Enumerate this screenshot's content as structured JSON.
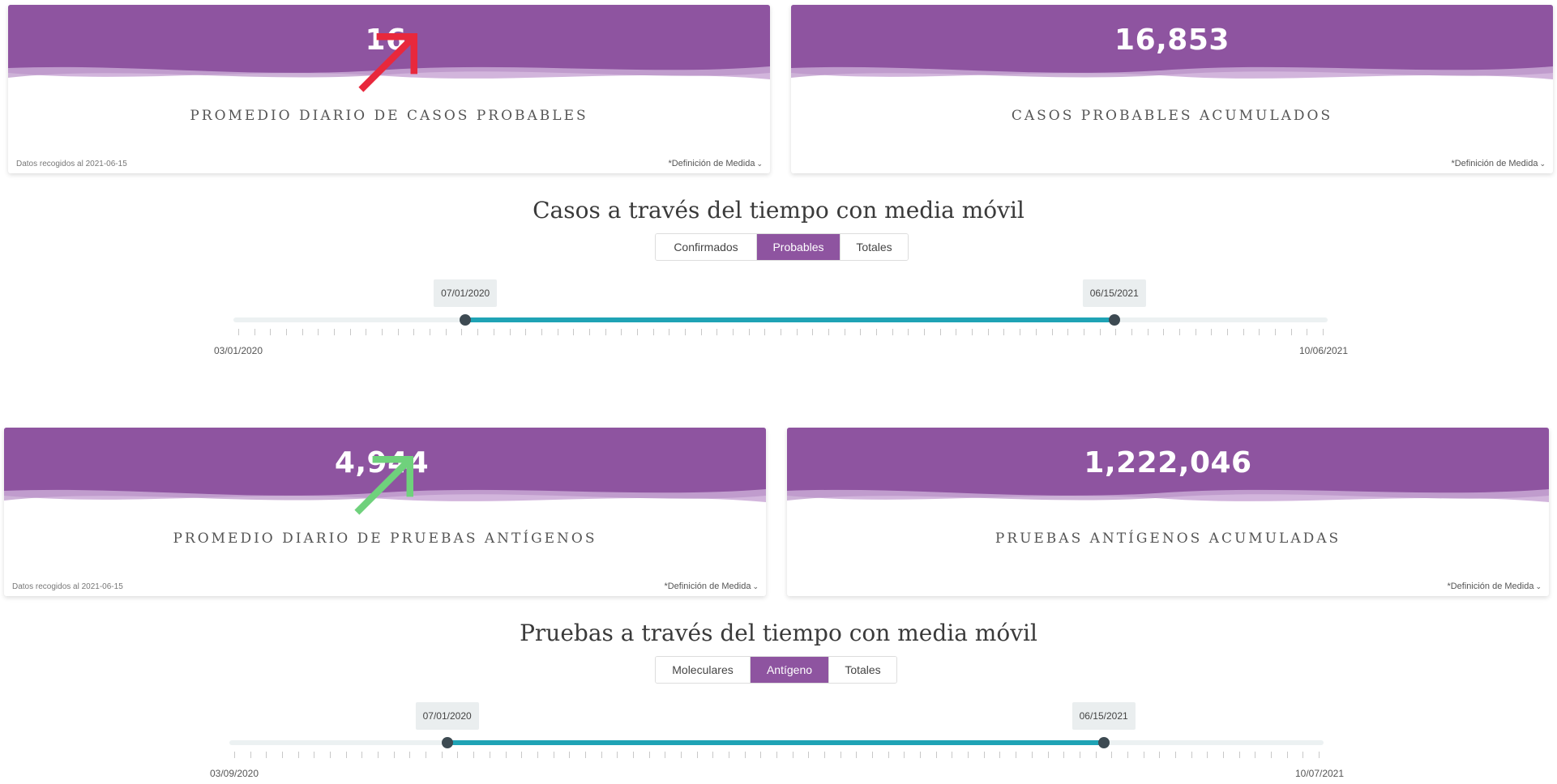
{
  "colors": {
    "header": "#8e54a0",
    "wave_light": "#d2b5dc",
    "wave_mid": "#b892c6",
    "accent_slider": "#1fa3b5",
    "arrow_up_red": "#e8283c",
    "arrow_up_green": "#6fd17c"
  },
  "cases": {
    "daily_avg": {
      "value": "16",
      "trend_icon": "arrow-up-red-icon",
      "label": "Promedio diario de casos probables",
      "note": "Datos recogidos al 2021-06-15",
      "definition": "*Definición de Medida"
    },
    "cumulative": {
      "value": "16,853",
      "label": "Casos probables acumulados",
      "definition": "*Definición de Medida"
    },
    "title": "Casos a través del tiempo con media móvil",
    "tabs": [
      {
        "label": "Confirmados",
        "active": false
      },
      {
        "label": "Probables",
        "active": true
      },
      {
        "label": "Totales",
        "active": false
      }
    ],
    "range": {
      "min_label": "03/01/2020",
      "max_label": "10/06/2021",
      "start_label": "07/01/2020",
      "end_label": "06/15/2021",
      "start_fraction": 0.212,
      "end_fraction": 0.805
    }
  },
  "tests": {
    "daily_avg": {
      "value": "4,944",
      "trend_icon": "arrow-up-green-icon",
      "label": "Promedio diario de pruebas antígenos",
      "note": "Datos recogidos al 2021-06-15",
      "definition": "*Definición de Medida"
    },
    "cumulative": {
      "value": "1,222,046",
      "label": "Pruebas antígenos acumuladas",
      "definition": "*Definición de Medida"
    },
    "title": "Pruebas a través del tiempo con media móvil",
    "tabs": [
      {
        "label": "Moleculares",
        "active": false
      },
      {
        "label": "Antígeno",
        "active": true
      },
      {
        "label": "Totales",
        "active": false
      }
    ],
    "range": {
      "min_label": "03/09/2020",
      "max_label": "10/07/2021",
      "start_label": "07/01/2020",
      "end_label": "06/15/2021",
      "start_fraction": 0.199,
      "end_fraction": 0.799
    }
  }
}
